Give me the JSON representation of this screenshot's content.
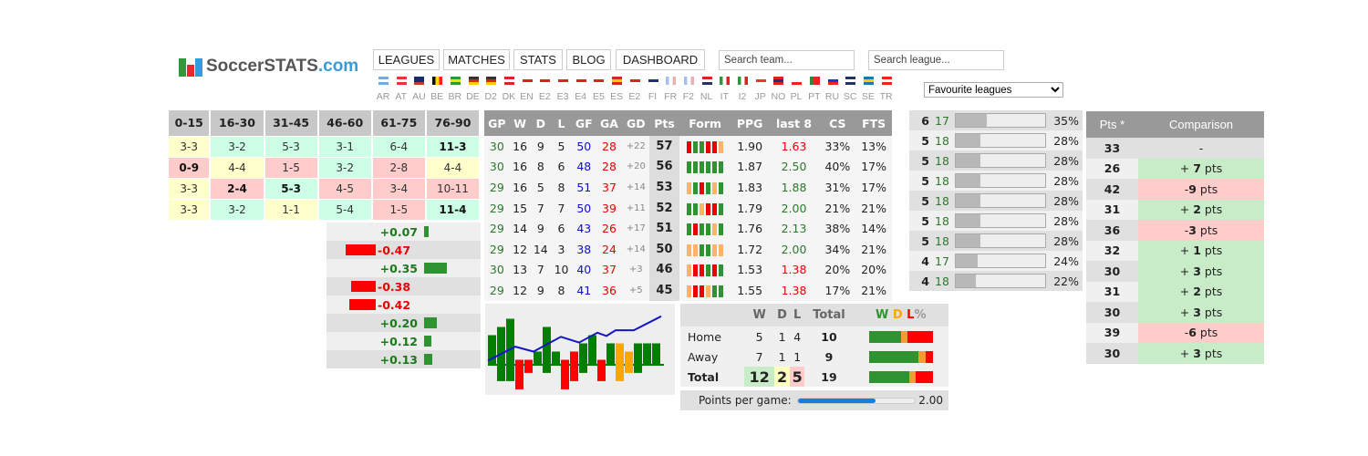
{
  "logo": {
    "text_main": "SoccerSTATS",
    "text_domain": ".com"
  },
  "nav": [
    {
      "label": "LEAGUES"
    },
    {
      "label": "MATCHES"
    },
    {
      "label": "STATS"
    },
    {
      "label": "BLOG"
    },
    {
      "label": "DASHBOARD"
    }
  ],
  "search": {
    "team_placeholder": "Search team...",
    "league_placeholder": "Search league..."
  },
  "flags": [
    "AR",
    "AT",
    "AU",
    "BE",
    "BR",
    "DE",
    "D2",
    "DK",
    "EN",
    "E2",
    "E3",
    "E4",
    "E5",
    "ES",
    "E2",
    "FI",
    "FR",
    "F2",
    "NL",
    "IT",
    "I2",
    "JP",
    "NO",
    "PL",
    "PT",
    "RU",
    "SC",
    "SE",
    "TR"
  ],
  "favourite_select": {
    "selected": "Favourite leagues"
  },
  "colors": {
    "green": "#2f9331",
    "red": "#ff0000",
    "orange": "#ffb366",
    "draw": "#ffa500",
    "blue": "#1010cc",
    "positive_text": "#1a7a1a"
  },
  "timing": {
    "headers": [
      "0-15",
      "16-30",
      "31-45",
      "46-60",
      "61-75",
      "76-90"
    ],
    "rows": [
      [
        {
          "v": "3-3",
          "c": "y"
        },
        {
          "v": "3-2",
          "c": "g"
        },
        {
          "v": "5-3",
          "c": "g"
        },
        {
          "v": "3-1",
          "c": "g"
        },
        {
          "v": "6-4",
          "c": "g"
        },
        {
          "v": "11-3",
          "c": "g",
          "b": 1
        }
      ],
      [
        {
          "v": "0-9",
          "c": "r",
          "b": 1
        },
        {
          "v": "4-4",
          "c": "y"
        },
        {
          "v": "1-5",
          "c": "r"
        },
        {
          "v": "3-2",
          "c": "g"
        },
        {
          "v": "2-8",
          "c": "r"
        },
        {
          "v": "4-4",
          "c": "y"
        }
      ],
      [
        {
          "v": "3-3",
          "c": "y"
        },
        {
          "v": "2-4",
          "c": "r",
          "b": 1
        },
        {
          "v": "5-3",
          "c": "g",
          "b": 1
        },
        {
          "v": "4-5",
          "c": "r"
        },
        {
          "v": "3-4",
          "c": "r"
        },
        {
          "v": "10-11",
          "c": "r"
        }
      ],
      [
        {
          "v": "3-3",
          "c": "y"
        },
        {
          "v": "3-2",
          "c": "g"
        },
        {
          "v": "1-1",
          "c": "y"
        },
        {
          "v": "5-4",
          "c": "g"
        },
        {
          "v": "1-5",
          "c": "r"
        },
        {
          "v": "11-4",
          "c": "g",
          "b": 1
        }
      ]
    ]
  },
  "ppg_diff": [
    {
      "label": "+0.07",
      "value": 0.07
    },
    {
      "label": "-0.47",
      "value": -0.47
    },
    {
      "label": "+0.35",
      "value": 0.35
    },
    {
      "label": "-0.38",
      "value": -0.38
    },
    {
      "label": "-0.42",
      "value": -0.42
    },
    {
      "label": "+0.20",
      "value": 0.2
    },
    {
      "label": "+0.12",
      "value": 0.12
    },
    {
      "label": "+0.13",
      "value": 0.13
    }
  ],
  "stats": {
    "headers": [
      "GP",
      "W",
      "D",
      "L",
      "GF",
      "GA",
      "GD",
      "Pts",
      "Form",
      "PPG",
      "last 8",
      "CS",
      "FTS"
    ],
    "rows": [
      {
        "gp": "30",
        "w": "16",
        "d": "9",
        "l": "5",
        "gf": "50",
        "ga": "28",
        "gd": "+22",
        "pts": "57",
        "form": "LWWLLD",
        "ppg": "1.90",
        "last8": "1.63",
        "last8_good": false,
        "cs": "33%",
        "fts": "13%"
      },
      {
        "gp": "30",
        "w": "16",
        "d": "8",
        "l": "6",
        "gf": "48",
        "ga": "28",
        "gd": "+20",
        "pts": "56",
        "form": "WWWWWW",
        "ppg": "1.87",
        "last8": "2.50",
        "last8_good": true,
        "cs": "40%",
        "fts": "17%"
      },
      {
        "gp": "29",
        "w": "16",
        "d": "5",
        "l": "8",
        "gf": "51",
        "ga": "37",
        "gd": "+14",
        "pts": "53",
        "form": "DWLWDW",
        "ppg": "1.83",
        "last8": "1.88",
        "last8_good": true,
        "cs": "31%",
        "fts": "17%"
      },
      {
        "gp": "29",
        "w": "15",
        "d": "7",
        "l": "7",
        "gf": "50",
        "ga": "39",
        "gd": "+11",
        "pts": "52",
        "form": "WWDLLW",
        "ppg": "1.79",
        "last8": "2.00",
        "last8_good": true,
        "cs": "21%",
        "fts": "21%"
      },
      {
        "gp": "29",
        "w": "14",
        "d": "9",
        "l": "6",
        "gf": "43",
        "ga": "26",
        "gd": "+17",
        "pts": "51",
        "form": "WLWWDW",
        "ppg": "1.76",
        "last8": "2.13",
        "last8_good": true,
        "cs": "38%",
        "fts": "14%"
      },
      {
        "gp": "29",
        "w": "12",
        "d": "14",
        "l": "3",
        "gf": "38",
        "ga": "24",
        "gd": "+14",
        "pts": "50",
        "form": "DDWWDD",
        "ppg": "1.72",
        "last8": "2.00",
        "last8_good": true,
        "cs": "34%",
        "fts": "21%"
      },
      {
        "gp": "30",
        "w": "13",
        "d": "7",
        "l": "10",
        "gf": "40",
        "ga": "37",
        "gd": "+3",
        "pts": "46",
        "form": "DLLWLW",
        "ppg": "1.53",
        "last8": "1.38",
        "last8_good": false,
        "cs": "20%",
        "fts": "20%"
      },
      {
        "gp": "29",
        "w": "12",
        "d": "9",
        "l": "8",
        "gf": "41",
        "ga": "36",
        "gd": "+5",
        "pts": "45",
        "form": "DLLDWW",
        "ppg": "1.55",
        "last8": "1.38",
        "last8_good": false,
        "cs": "17%",
        "fts": "21%"
      }
    ]
  },
  "chart_data": {
    "type": "bar",
    "columns": [
      {
        "up": 3.5,
        "down": 0,
        "color": "green"
      },
      {
        "up": 4.5,
        "down": -2.1,
        "color": "green"
      },
      {
        "up": 5.5,
        "down": -2.1,
        "color": "green"
      },
      {
        "up": 0.5,
        "down": -3.1,
        "color": "red"
      },
      {
        "up": 0.5,
        "down": -1.1,
        "color": "red"
      },
      {
        "up": 1.5,
        "down": 0,
        "color": "green"
      },
      {
        "up": 4.5,
        "down": -1.1,
        "color": "green"
      },
      {
        "up": 1.5,
        "down": 0,
        "color": "green"
      },
      {
        "up": 0.5,
        "down": -3.1,
        "color": "red"
      },
      {
        "up": 1.5,
        "down": -2.1,
        "color": "red"
      },
      {
        "up": 2.5,
        "down": -1.1,
        "color": "green"
      },
      {
        "up": 3.5,
        "down": 0,
        "color": "green"
      },
      {
        "up": 0.5,
        "down": -2.1,
        "color": "red"
      },
      {
        "up": 2.5,
        "down": 0,
        "color": "green"
      },
      {
        "up": 2.5,
        "down": -2.1,
        "color": "orange"
      },
      {
        "up": 1.5,
        "down": -1.1,
        "color": "orange"
      },
      {
        "up": 2.5,
        "down": -1.1,
        "color": "green"
      },
      {
        "up": 2.5,
        "down": 0,
        "color": "green"
      },
      {
        "up": 2.5,
        "down": 0,
        "color": "green"
      }
    ],
    "line": [
      [
        0,
        0.4
      ],
      [
        3,
        2.1
      ],
      [
        5,
        1.5
      ],
      [
        8,
        3.3
      ],
      [
        10,
        2.6
      ],
      [
        12,
        3.8
      ],
      [
        13,
        3.4
      ],
      [
        14,
        4.1
      ],
      [
        16,
        4.1
      ],
      [
        19,
        5.8
      ]
    ]
  },
  "wdl": {
    "headers": [
      "W",
      "D",
      "L",
      "Total"
    ],
    "legend": {
      "w": "W",
      "d": "D",
      "l": "L",
      "pct": "%"
    },
    "rows": [
      {
        "label": "Home",
        "w": "5",
        "d": "1",
        "l": "4",
        "total": "10"
      },
      {
        "label": "Away",
        "w": "7",
        "d": "1",
        "l": "1",
        "total": "9"
      },
      {
        "label": "Total",
        "w": "12",
        "d": "2",
        "l": "5",
        "total": "19"
      }
    ],
    "ppg_label": "Points per game:",
    "ppg_value": "2.00",
    "ppg_fraction": 0.67
  },
  "right_bars": [
    {
      "a": "6",
      "b": "17",
      "pct": "35%",
      "v": 35
    },
    {
      "a": "5",
      "b": "18",
      "pct": "28%",
      "v": 28
    },
    {
      "a": "5",
      "b": "18",
      "pct": "28%",
      "v": 28
    },
    {
      "a": "5",
      "b": "18",
      "pct": "28%",
      "v": 28
    },
    {
      "a": "5",
      "b": "18",
      "pct": "28%",
      "v": 28
    },
    {
      "a": "5",
      "b": "18",
      "pct": "28%",
      "v": 28
    },
    {
      "a": "5",
      "b": "18",
      "pct": "28%",
      "v": 28
    },
    {
      "a": "4",
      "b": "17",
      "pct": "24%",
      "v": 24
    },
    {
      "a": "4",
      "b": "18",
      "pct": "22%",
      "v": 22
    }
  ],
  "comparison": {
    "headers": [
      "Pts *",
      "Comparison"
    ],
    "unit": "pts",
    "rows": [
      {
        "pts": "33",
        "cmp": "-",
        "sign": "",
        "type": "none"
      },
      {
        "pts": "26",
        "cmp": "7",
        "sign": "+ ",
        "type": "up"
      },
      {
        "pts": "42",
        "cmp": "9",
        "sign": "-",
        "type": "down"
      },
      {
        "pts": "31",
        "cmp": "2",
        "sign": "+ ",
        "type": "up"
      },
      {
        "pts": "36",
        "cmp": "3",
        "sign": "-",
        "type": "down"
      },
      {
        "pts": "32",
        "cmp": "1",
        "sign": "+ ",
        "type": "up"
      },
      {
        "pts": "30",
        "cmp": "3",
        "sign": "+ ",
        "type": "up"
      },
      {
        "pts": "31",
        "cmp": "2",
        "sign": "+ ",
        "type": "up"
      },
      {
        "pts": "30",
        "cmp": "3",
        "sign": "+ ",
        "type": "up"
      },
      {
        "pts": "39",
        "cmp": "6",
        "sign": "-",
        "type": "down"
      },
      {
        "pts": "30",
        "cmp": "3",
        "sign": "+ ",
        "type": "up"
      }
    ]
  }
}
